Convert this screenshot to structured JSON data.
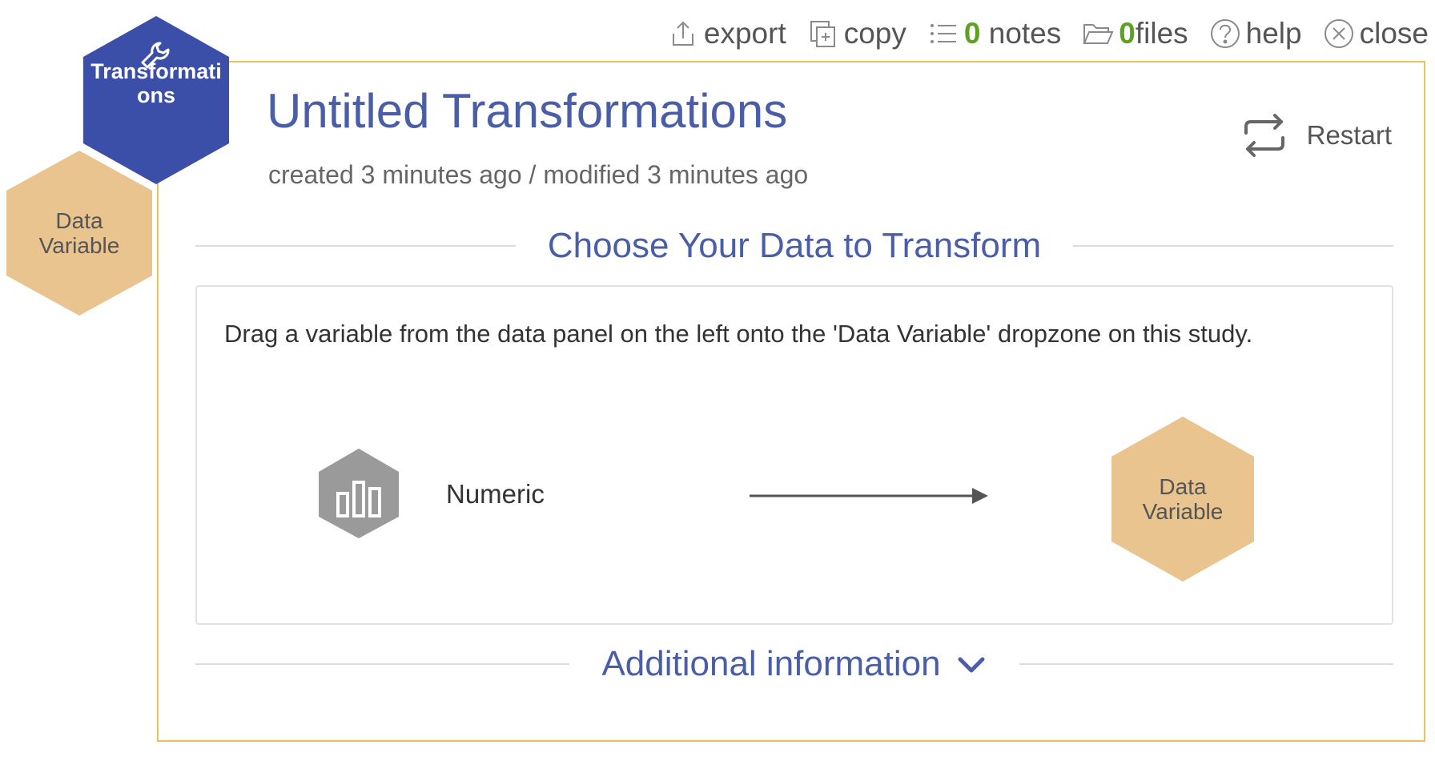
{
  "toolbar": {
    "export_label": "export",
    "copy_label": "copy",
    "notes_count": "0",
    "notes_label": "notes",
    "files_count": "0",
    "files_label": "files",
    "help_label": "help",
    "close_label": "close"
  },
  "sidebar": {
    "transformations_label_line1": "Transformati",
    "transformations_label_line2": "ons",
    "data_variable_line1": "Data",
    "data_variable_line2": "Variable"
  },
  "study": {
    "title": "Untitled Transformations",
    "subtitle": "created 3 minutes ago / modified 3 minutes ago",
    "restart_label": "Restart"
  },
  "choose": {
    "heading": "Choose Your Data to Transform",
    "instructions": "Drag a variable from the data panel on the left onto the 'Data Variable' dropzone on this study.",
    "variable_type": "Numeric",
    "dropzone_line1": "Data",
    "dropzone_line2": "Variable"
  },
  "additional": {
    "label": "Additional information"
  },
  "colors": {
    "accent_blue": "#4a5ea8",
    "hex_blue": "#3b4fa8",
    "hex_tan": "#e9c48e",
    "card_border": "#e8c25a",
    "count_green": "#5ea021",
    "icon_gray": "#9a9a9a"
  },
  "icons": [
    "export-icon",
    "copy-icon",
    "notes-icon",
    "folder-icon",
    "help-icon",
    "close-icon",
    "wrench-icon",
    "restart-icon",
    "bar-chart-icon",
    "arrow-right-icon",
    "chevron-down-icon"
  ]
}
